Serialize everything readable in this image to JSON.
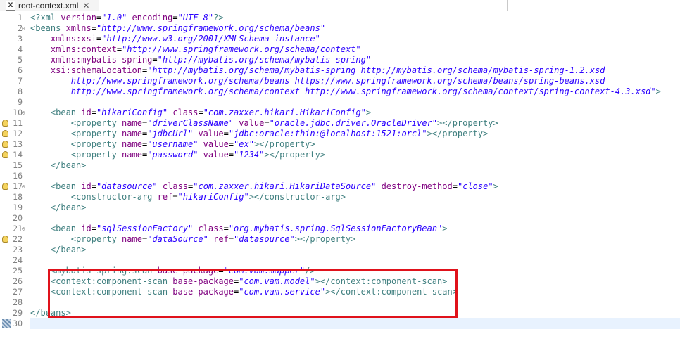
{
  "tab": {
    "title": "root-context.xml",
    "icon": "xml-file-icon",
    "close_glyph": "✕",
    "icon_letter": "X"
  },
  "accent_colors": {
    "highlight": "#e0121b",
    "current_line": "#e8f2fe"
  },
  "lines": [
    {
      "n": "1",
      "parts": [
        [
          "tag",
          "<?xml "
        ],
        [
          "attr",
          "version"
        ],
        [
          "plain",
          "="
        ],
        [
          "str",
          "\"1.0\""
        ],
        [
          "plain",
          " "
        ],
        [
          "attr",
          "encoding"
        ],
        [
          "plain",
          "="
        ],
        [
          "str",
          "\"UTF-8\""
        ],
        [
          "tag",
          "?>"
        ]
      ]
    },
    {
      "n": "2",
      "fold": true,
      "parts": [
        [
          "tag",
          "<beans "
        ],
        [
          "attr",
          "xmlns"
        ],
        [
          "plain",
          "="
        ],
        [
          "str",
          "\"http://www.springframework.org/schema/beans\""
        ]
      ]
    },
    {
      "n": "3",
      "parts": [
        [
          "plain",
          "    "
        ],
        [
          "attr",
          "xmlns:xsi"
        ],
        [
          "plain",
          "="
        ],
        [
          "str",
          "\"http://www.w3.org/2001/XMLSchema-instance\""
        ]
      ]
    },
    {
      "n": "4",
      "parts": [
        [
          "plain",
          "    "
        ],
        [
          "attr",
          "xmlns:context"
        ],
        [
          "plain",
          "="
        ],
        [
          "str",
          "\"http://www.springframework.org/schema/context\""
        ]
      ]
    },
    {
      "n": "5",
      "parts": [
        [
          "plain",
          "    "
        ],
        [
          "attr",
          "xmlns:mybatis-spring"
        ],
        [
          "plain",
          "="
        ],
        [
          "str",
          "\"http://mybatis.org/schema/mybatis-spring\""
        ]
      ]
    },
    {
      "n": "6",
      "parts": [
        [
          "plain",
          "    "
        ],
        [
          "attr",
          "xsi:schemaLocation"
        ],
        [
          "plain",
          "="
        ],
        [
          "str",
          "\"http://mybatis.org/schema/mybatis-spring http://mybatis.org/schema/mybatis-spring-1.2.xsd"
        ]
      ]
    },
    {
      "n": "7",
      "parts": [
        [
          "plain",
          "        "
        ],
        [
          "str",
          "http://www.springframework.org/schema/beans https://www.springframework.org/schema/beans/spring-beans.xsd"
        ]
      ]
    },
    {
      "n": "8",
      "parts": [
        [
          "plain",
          "        "
        ],
        [
          "str",
          "http://www.springframework.org/schema/context http://www.springframework.org/schema/context/spring-context-4.3.xsd\""
        ],
        [
          "tag",
          ">"
        ]
      ]
    },
    {
      "n": "9",
      "parts": []
    },
    {
      "n": "10",
      "fold": true,
      "parts": [
        [
          "plain",
          "    "
        ],
        [
          "tag",
          "<bean "
        ],
        [
          "attr",
          "id"
        ],
        [
          "plain",
          "="
        ],
        [
          "str",
          "\"hikariConfig\""
        ],
        [
          "plain",
          " "
        ],
        [
          "attr",
          "class"
        ],
        [
          "plain",
          "="
        ],
        [
          "str",
          "\"com.zaxxer.hikari.HikariConfig\""
        ],
        [
          "tag",
          ">"
        ]
      ]
    },
    {
      "n": "11",
      "warn": true,
      "parts": [
        [
          "plain",
          "        "
        ],
        [
          "tag",
          "<property "
        ],
        [
          "attr",
          "name"
        ],
        [
          "plain",
          "="
        ],
        [
          "str",
          "\"driverClassName\""
        ],
        [
          "plain",
          " "
        ],
        [
          "attr",
          "value"
        ],
        [
          "plain",
          "="
        ],
        [
          "str",
          "\"oracle.jdbc.driver.OracleDriver\""
        ],
        [
          "tag",
          "></property>"
        ]
      ]
    },
    {
      "n": "12",
      "warn": true,
      "parts": [
        [
          "plain",
          "        "
        ],
        [
          "tag",
          "<property "
        ],
        [
          "attr",
          "name"
        ],
        [
          "plain",
          "="
        ],
        [
          "str",
          "\"jdbcUrl\""
        ],
        [
          "plain",
          " "
        ],
        [
          "attr",
          "value"
        ],
        [
          "plain",
          "="
        ],
        [
          "str",
          "\"jdbc:oracle:thin:@localhost:1521:orcl\""
        ],
        [
          "tag",
          "></property>"
        ]
      ]
    },
    {
      "n": "13",
      "warn": true,
      "parts": [
        [
          "plain",
          "        "
        ],
        [
          "tag",
          "<property "
        ],
        [
          "attr",
          "name"
        ],
        [
          "plain",
          "="
        ],
        [
          "str",
          "\"username\""
        ],
        [
          "plain",
          " "
        ],
        [
          "attr",
          "value"
        ],
        [
          "plain",
          "="
        ],
        [
          "str",
          "\"ex\""
        ],
        [
          "tag",
          "></property>"
        ]
      ]
    },
    {
      "n": "14",
      "warn": true,
      "parts": [
        [
          "plain",
          "        "
        ],
        [
          "tag",
          "<property "
        ],
        [
          "attr",
          "name"
        ],
        [
          "plain",
          "="
        ],
        [
          "str",
          "\"password\""
        ],
        [
          "plain",
          " "
        ],
        [
          "attr",
          "value"
        ],
        [
          "plain",
          "="
        ],
        [
          "str",
          "\"1234\""
        ],
        [
          "tag",
          "></property>"
        ]
      ]
    },
    {
      "n": "15",
      "parts": [
        [
          "plain",
          "    "
        ],
        [
          "tag",
          "</bean>"
        ]
      ]
    },
    {
      "n": "16",
      "parts": []
    },
    {
      "n": "17",
      "fold": true,
      "warn": true,
      "parts": [
        [
          "plain",
          "    "
        ],
        [
          "tag",
          "<bean "
        ],
        [
          "attr",
          "id"
        ],
        [
          "plain",
          "="
        ],
        [
          "str",
          "\"datasource\""
        ],
        [
          "plain",
          " "
        ],
        [
          "attr",
          "class"
        ],
        [
          "plain",
          "="
        ],
        [
          "str",
          "\"com.zaxxer.hikari.HikariDataSource\""
        ],
        [
          "plain",
          " "
        ],
        [
          "attr",
          "destroy-method"
        ],
        [
          "plain",
          "="
        ],
        [
          "str",
          "\"close\""
        ],
        [
          "tag",
          ">"
        ]
      ]
    },
    {
      "n": "18",
      "parts": [
        [
          "plain",
          "        "
        ],
        [
          "tag",
          "<constructor-arg "
        ],
        [
          "attr",
          "ref"
        ],
        [
          "plain",
          "="
        ],
        [
          "str",
          "\"hikariConfig\""
        ],
        [
          "tag",
          "></constructor-arg>"
        ]
      ]
    },
    {
      "n": "19",
      "parts": [
        [
          "plain",
          "    "
        ],
        [
          "tag",
          "</bean>"
        ]
      ]
    },
    {
      "n": "20",
      "parts": []
    },
    {
      "n": "21",
      "fold": true,
      "parts": [
        [
          "plain",
          "    "
        ],
        [
          "tag",
          "<bean "
        ],
        [
          "attr",
          "id"
        ],
        [
          "plain",
          "="
        ],
        [
          "str",
          "\"sqlSessionFactory\""
        ],
        [
          "plain",
          " "
        ],
        [
          "attr",
          "class"
        ],
        [
          "plain",
          "="
        ],
        [
          "str",
          "\"org.mybatis.spring.SqlSessionFactoryBean\""
        ],
        [
          "tag",
          ">"
        ]
      ]
    },
    {
      "n": "22",
      "warn": true,
      "parts": [
        [
          "plain",
          "        "
        ],
        [
          "tag",
          "<property "
        ],
        [
          "attr",
          "name"
        ],
        [
          "plain",
          "="
        ],
        [
          "str",
          "\"dataSource\""
        ],
        [
          "plain",
          " "
        ],
        [
          "attr",
          "ref"
        ],
        [
          "plain",
          "="
        ],
        [
          "str",
          "\"datasource\""
        ],
        [
          "tag",
          "></property>"
        ]
      ]
    },
    {
      "n": "23",
      "parts": [
        [
          "plain",
          "    "
        ],
        [
          "tag",
          "</bean>"
        ]
      ]
    },
    {
      "n": "24",
      "parts": []
    },
    {
      "n": "25",
      "parts": [
        [
          "plain",
          "    "
        ],
        [
          "tag",
          "<mybatis-spring:scan "
        ],
        [
          "attr",
          "base-package"
        ],
        [
          "plain",
          "="
        ],
        [
          "str",
          "\"com.vam.mapper\""
        ],
        [
          "tag",
          "/>"
        ]
      ]
    },
    {
      "n": "26",
      "parts": [
        [
          "plain",
          "    "
        ],
        [
          "tag",
          "<context:component-scan "
        ],
        [
          "attr",
          "base-package"
        ],
        [
          "plain",
          "="
        ],
        [
          "str",
          "\"com.vam.model\""
        ],
        [
          "tag",
          "></context:component-scan>"
        ]
      ]
    },
    {
      "n": "27",
      "parts": [
        [
          "plain",
          "    "
        ],
        [
          "tag",
          "<context:component-scan "
        ],
        [
          "attr",
          "base-package"
        ],
        [
          "plain",
          "="
        ],
        [
          "str",
          "\"com.vam.service\""
        ],
        [
          "tag",
          "></context:component-scan>"
        ]
      ]
    },
    {
      "n": "28",
      "parts": []
    },
    {
      "n": "29",
      "parts": [
        [
          "tag",
          "</beans>"
        ]
      ]
    },
    {
      "n": "30",
      "current": true,
      "bookmark": true,
      "parts": []
    }
  ]
}
